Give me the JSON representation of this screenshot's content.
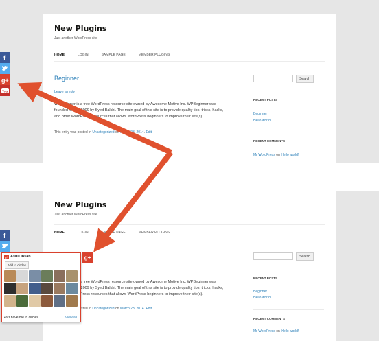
{
  "site": {
    "title": "New Plugins",
    "tagline": "Just another WordPress site",
    "nav": [
      "HOME",
      "LOGIN",
      "SAMPLE PAGE",
      "MEMBER PLUGINS"
    ]
  },
  "post": {
    "title": "Beginner",
    "reply": "Leave a reply",
    "body": "WPBeginner is a free WordPress resource site owned by Awesome Motive Inc. WPBeginner was founded in July 2009 by Syed Balkhi. The main goal of this site is to provide quality tips, tricks, hacks, and other WordPress resources that allows WordPress beginners to improve their site(s).",
    "meta_prefix": "This entry was posted in",
    "meta_category": "Uncategorized",
    "meta_on": "on",
    "meta_date": "March 23, 2014",
    "meta_edit": "Edit"
  },
  "sidebar": {
    "search_button": "Search",
    "recent_posts_heading": "RECENT POSTS",
    "recent_posts": [
      "Beginner",
      "Hello world!"
    ],
    "recent_comments_heading": "RECENT COMMENTS",
    "comment_author": "Mr WordPress",
    "comment_on": "on",
    "comment_post": "Hello world!"
  },
  "share_bar": {
    "buttons": [
      {
        "name": "facebook",
        "glyph": "f",
        "color": "#3b5998"
      },
      {
        "name": "twitter",
        "glyph": "t",
        "color": "#55acee"
      },
      {
        "name": "google-plus",
        "glyph": "g+",
        "color": "#d9412d"
      },
      {
        "name": "youtube",
        "glyph": "You",
        "color": "#c4302b"
      }
    ]
  },
  "gplus_popup": {
    "name": "Ashu Insan",
    "add_button": "Add to circles",
    "count_text": "493 have me in circles",
    "view_all": "View all",
    "tab_glyph": "g+",
    "avatars": [
      "#b98a58",
      "#d8d8d8",
      "#7a8ea6",
      "#6b7d5a",
      "#8a6f5c",
      "#a8926c",
      "#2e2e2e",
      "#c7a37e",
      "#425e8c",
      "#5a4a3e",
      "#9a7a60",
      "#6c8a9e",
      "#d2b48c",
      "#4b6b3a",
      "#e0c9a6",
      "#8c5a3c",
      "#5f6f86",
      "#a07a4d"
    ]
  },
  "colors": {
    "arrow": "#e0512e",
    "link": "#2a7fb8",
    "google_red": "#d9412d"
  }
}
